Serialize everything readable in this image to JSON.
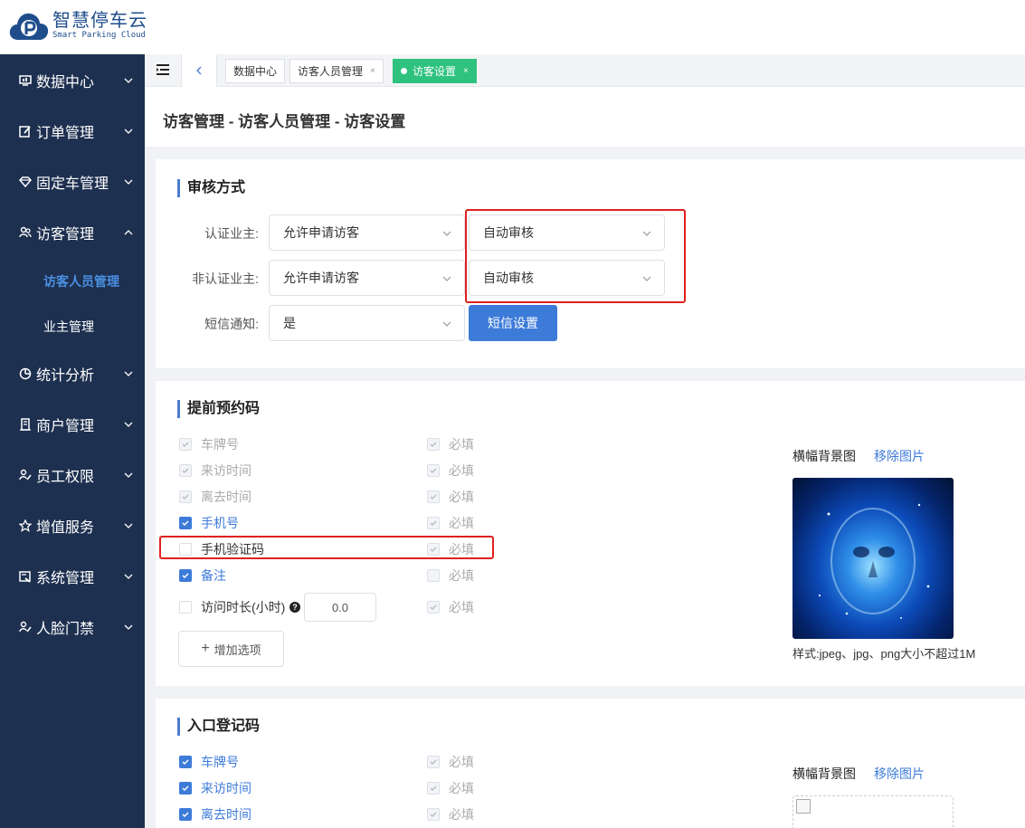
{
  "brand": {
    "name_cn": "智慧停车云",
    "name_en": "Smart Parking Cloud",
    "color": "#1f4d8c"
  },
  "sidebar": {
    "items": [
      {
        "label": "数据中心",
        "icon": "monitor-icon",
        "expanded": false
      },
      {
        "label": "订单管理",
        "icon": "edit-icon",
        "expanded": false
      },
      {
        "label": "固定车管理",
        "icon": "diamond-icon",
        "expanded": false
      },
      {
        "label": "访客管理",
        "icon": "users-icon",
        "expanded": true
      },
      {
        "label": "统计分析",
        "icon": "pie-icon",
        "expanded": false
      },
      {
        "label": "商户管理",
        "icon": "building-icon",
        "expanded": false
      },
      {
        "label": "员工权限",
        "icon": "user-key-icon",
        "expanded": false
      },
      {
        "label": "增值服务",
        "icon": "star-icon",
        "expanded": false
      },
      {
        "label": "系统管理",
        "icon": "settings-icon",
        "expanded": false
      },
      {
        "label": "人脸门禁",
        "icon": "face-icon",
        "expanded": false
      }
    ],
    "sub_items": [
      {
        "label": "访客人员管理",
        "active": true
      },
      {
        "label": "业主管理",
        "active": false
      }
    ]
  },
  "tabs": [
    {
      "label": "数据中心",
      "closable": false,
      "active": false
    },
    {
      "label": "访客人员管理",
      "closable": true,
      "active": false
    },
    {
      "label": "访客设置",
      "closable": true,
      "active": true
    }
  ],
  "close_glyph": "×",
  "breadcrumb": "访客管理 - 访客人员管理 - 访客设置",
  "review": {
    "title": "审核方式",
    "rows": [
      {
        "label": "认证业主:",
        "select1": "允许申请访客",
        "select2": "自动审核"
      },
      {
        "label": "非认证业主:",
        "select1": "允许申请访客",
        "select2": "自动审核"
      },
      {
        "label": "短信通知:",
        "select1": "是",
        "button": "短信设置"
      }
    ]
  },
  "advance": {
    "title": "提前预约码",
    "required_label": "必填",
    "fields": [
      {
        "label": "车牌号",
        "checked": true,
        "disabled": true,
        "required_checked": true,
        "required_disabled": true
      },
      {
        "label": "来访时间",
        "checked": true,
        "disabled": true,
        "required_checked": true,
        "required_disabled": true
      },
      {
        "label": "离去时间",
        "checked": true,
        "disabled": true,
        "required_checked": true,
        "required_disabled": true
      },
      {
        "label": "手机号",
        "checked": true,
        "disabled": false,
        "required_checked": true,
        "required_disabled": true
      },
      {
        "label": "手机验证码",
        "checked": false,
        "disabled": false,
        "required_checked": true,
        "required_disabled": true
      },
      {
        "label": "备注",
        "checked": true,
        "disabled": false,
        "required_checked": false,
        "required_disabled": true
      }
    ],
    "duration": {
      "label": "访问时长(小时)",
      "help": "?",
      "value": "0.0",
      "required_checked": true
    },
    "add_button": "增加选项",
    "add_glyph": "+",
    "banner_label": "横幅背景图",
    "remove_label": "移除图片",
    "hint": "样式:jpeg、jpg、png大小不超过1M"
  },
  "entry": {
    "title": "入口登记码",
    "required_label": "必填",
    "fields": [
      {
        "label": "车牌号",
        "checked": true
      },
      {
        "label": "来访时间",
        "checked": true
      },
      {
        "label": "离去时间",
        "checked": true
      }
    ],
    "banner_label": "横幅背景图",
    "remove_label": "移除图片"
  },
  "colors": {
    "primary": "#3d7bd9",
    "sidebar_bg": "#1e3050",
    "active_tab": "#2ec27e",
    "highlight": "#e02020"
  }
}
